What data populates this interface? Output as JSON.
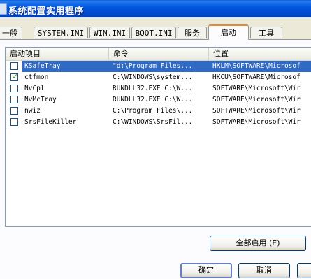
{
  "window": {
    "title": "系统配置实用程序"
  },
  "tabs": [
    "一般",
    "SYSTEM.INI",
    "WIN.INI",
    "BOOT.INI",
    "服务",
    "启动",
    "工具"
  ],
  "active_tab": "启动",
  "list": {
    "columns": [
      "启动项目",
      "命令",
      "位置"
    ],
    "rows": [
      {
        "checked": false,
        "selected": true,
        "item": "KSafeTray",
        "command": "\"d:\\Program Files...",
        "location": "HKLM\\SOFTWARE\\Microsof"
      },
      {
        "checked": true,
        "selected": false,
        "item": "ctfmon",
        "command": "C:\\WINDOWS\\system...",
        "location": "HKCU\\SOFTWARE\\Microsof"
      },
      {
        "checked": false,
        "selected": false,
        "item": "NvCpl",
        "command": "RUNDLL32.EXE C:\\W...",
        "location": "SOFTWARE\\Microsoft\\Wir"
      },
      {
        "checked": false,
        "selected": false,
        "item": "NvMcTray",
        "command": "RUNDLL32.EXE C:\\W...",
        "location": "SOFTWARE\\Microsoft\\Wir"
      },
      {
        "checked": false,
        "selected": false,
        "item": "nwiz",
        "command": "C:\\Program Files\\...",
        "location": "SOFTWARE\\Microsoft\\Wir"
      },
      {
        "checked": false,
        "selected": false,
        "item": "SrsFileKiller",
        "command": "C:\\WINDOWS\\SrsFil...",
        "location": "SOFTWARE\\Microsoft\\Wir"
      }
    ]
  },
  "buttons": {
    "enable_all": "全部启用",
    "enable_all_hotkey": "(E)",
    "ok": "确定",
    "cancel": "取消"
  },
  "icons": {
    "app": "window-app-icon",
    "check": "checkmark-icon"
  }
}
